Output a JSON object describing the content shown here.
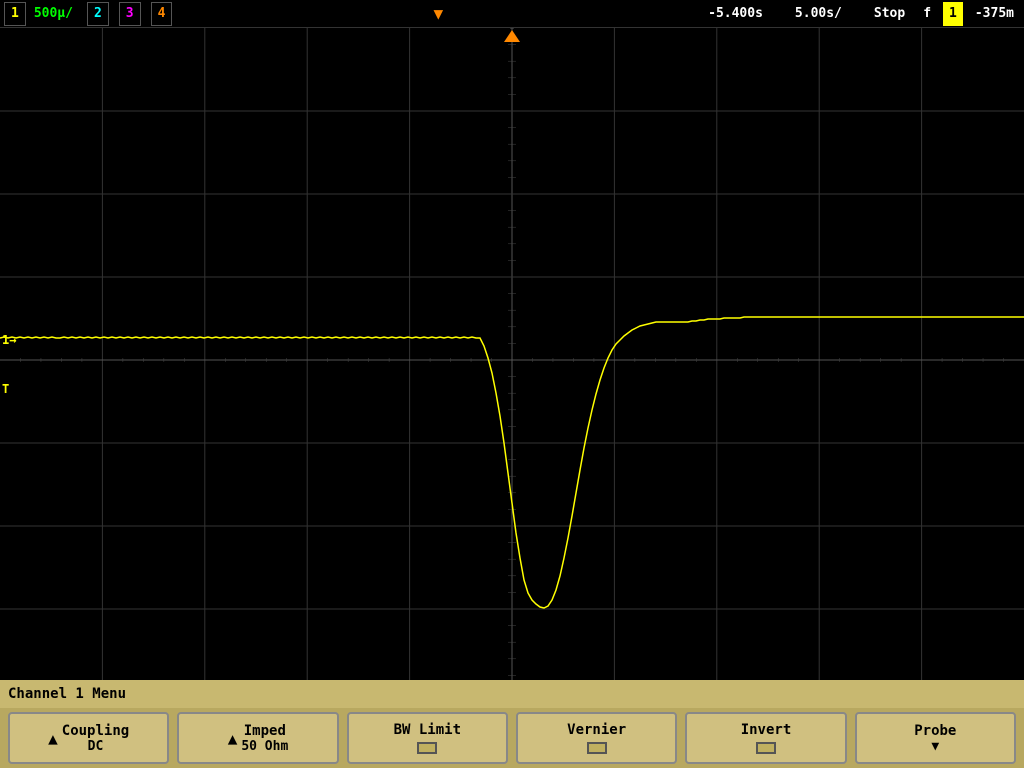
{
  "header": {
    "ch1_label": "1",
    "ch1_scale": "500μ/",
    "ch2_label": "2",
    "ch3_label": "3",
    "ch4_label": "4",
    "time_ref": "-5.400s",
    "time_scale": "5.00s/",
    "status": "Stop",
    "trig_icon": "f",
    "ch1_box": "1",
    "neg_val": "-375m"
  },
  "screen": {
    "grid_cols": 10,
    "grid_rows": 8,
    "trigger_marker": "▼",
    "ch1_level_marker": "1→",
    "ch1_ground_marker": "T"
  },
  "info_bar": {
    "text": "Channel 1  Menu"
  },
  "buttons": [
    {
      "id": "coupling",
      "has_arrow": true,
      "label": "Coupling",
      "value": "DC"
    },
    {
      "id": "imped",
      "has_arrow": true,
      "label": "Imped",
      "value": "50 Ohm"
    },
    {
      "id": "bw_limit",
      "has_arrow": false,
      "label": "BW Limit",
      "value": ""
    },
    {
      "id": "vernier",
      "has_arrow": false,
      "label": "Vernier",
      "value": ""
    },
    {
      "id": "invert",
      "has_arrow": false,
      "label": "Invert",
      "value": ""
    },
    {
      "id": "probe",
      "has_arrow": false,
      "label": "Probe",
      "value": "▼"
    }
  ]
}
